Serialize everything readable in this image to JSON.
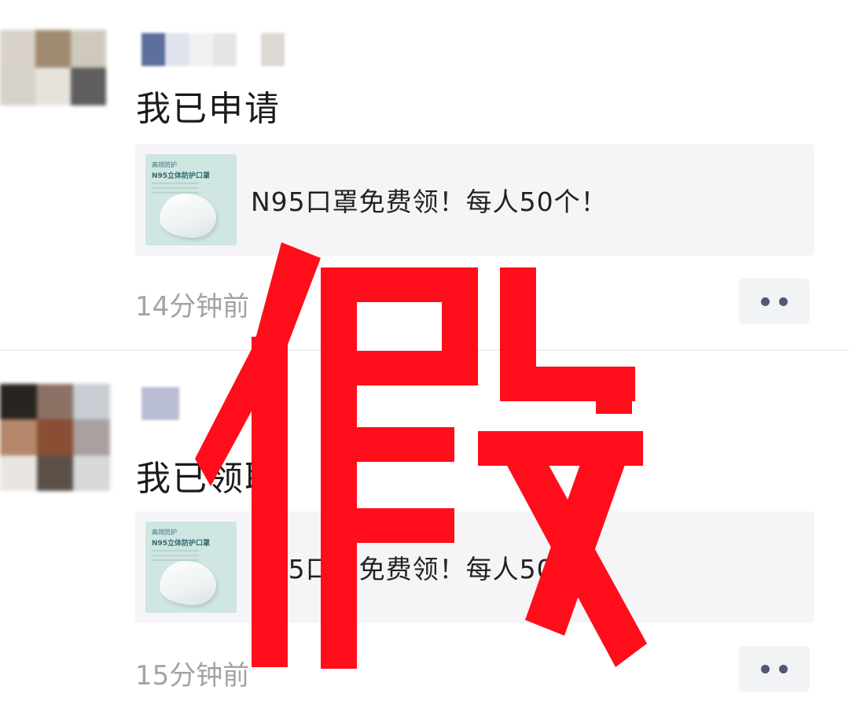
{
  "colors": {
    "stamp_red": "#ff0d1a",
    "text_primary": "#1b1b1b",
    "text_secondary": "#a3a3a3",
    "card_background": "#f5f5f7",
    "more_dots": "#4f5a78"
  },
  "posts": [
    {
      "status": "我已申请",
      "card": {
        "title": "N95口罩免费领！每人50个！",
        "thumb_brand": "高效防护",
        "thumb_title": "N95立体防护口罩"
      },
      "time": "14分钟前",
      "avatar_tiles": [
        "#d8d2ca",
        "#a08a72",
        "#cfc8bc",
        "#d6d1c9",
        "#e7e3dc",
        "#5f5d5e"
      ],
      "nickname_tiles": [
        "#5c6f9f",
        "#dfe3ee",
        "#f1f1f1",
        "#e6e6e8",
        "#ffffff",
        "#ddd8d2"
      ]
    },
    {
      "status": "我已领取",
      "card": {
        "title": "N95口罩免费领！每人50个！",
        "thumb_brand": "高效防护",
        "thumb_title": "N95立体防护口罩"
      },
      "time": "15分钟前",
      "avatar_tiles": [
        "#2a2420",
        "#8b7264",
        "#c9cdd3",
        "#b4876a",
        "#8a4e34",
        "#a9a19f",
        "#e9e6e2",
        "#5a5048",
        "#d8d8d8"
      ],
      "nickname_tiles": [
        "#b9bdd4"
      ]
    }
  ],
  "stamp": {
    "text": "假"
  }
}
